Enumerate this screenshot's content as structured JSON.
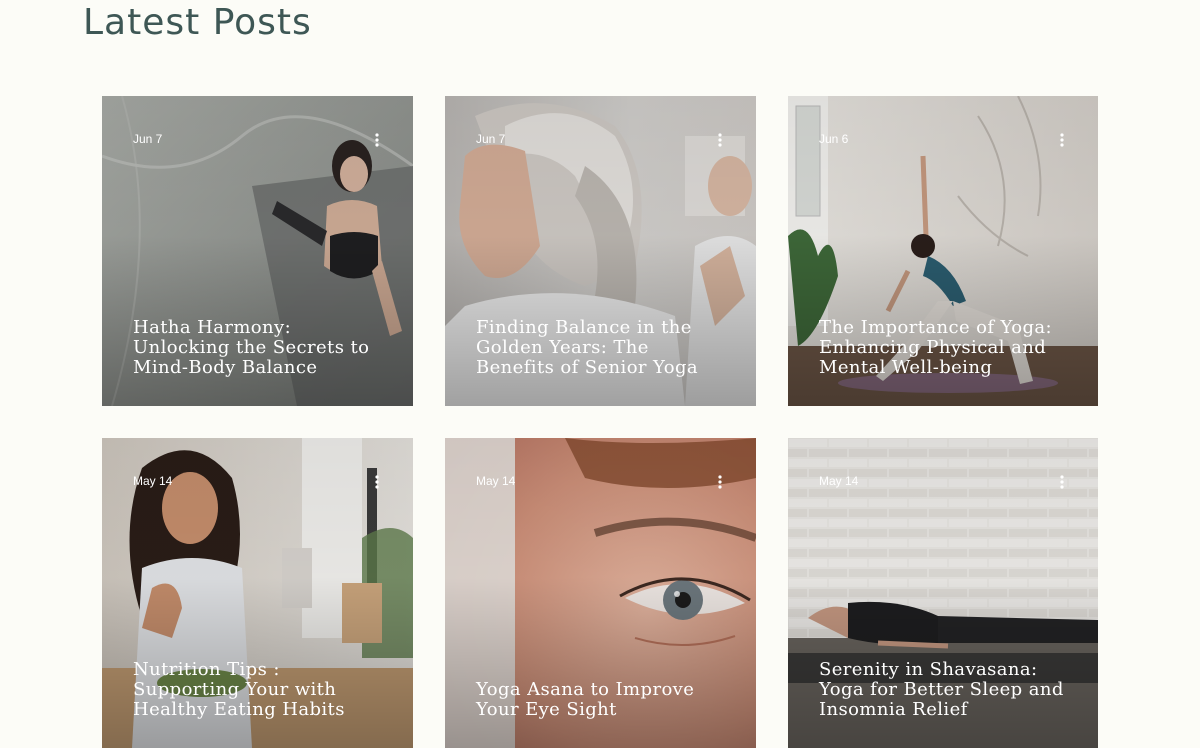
{
  "page": {
    "title": "Latest Posts"
  },
  "posts": [
    {
      "date": "Jun 7",
      "title": "Hatha Harmony: Unlocking the Secrets to Mind-Body Balance",
      "image": "woman-yoga-mat-stone-floor",
      "colors": [
        "#9ea19c",
        "#7e837f"
      ]
    },
    {
      "date": "Jun 7",
      "title": "Finding Balance in the Golden Years: The Benefits of Senior Yoga",
      "image": "senior-woman-ponytail",
      "colors": [
        "#c8c6c4",
        "#a9a5a2"
      ]
    },
    {
      "date": "Jun 6",
      "title": "The Importance of Yoga: Enhancing Physical and Mental Well-being",
      "image": "woman-yoga-pose-marble-room",
      "colors": [
        "#ddd8d2",
        "#7b6a5c"
      ]
    },
    {
      "date": "May 14",
      "title": "Nutrition Tips : Supporting Your with Healthy Eating Habits",
      "image": "woman-eating-salad",
      "colors": [
        "#c9bfb4",
        "#8a7968"
      ]
    },
    {
      "date": "May 14",
      "title": "Yoga Asana to Improve Your Eye Sight",
      "image": "close-up-eye",
      "colors": [
        "#d9a792",
        "#a86b55"
      ]
    },
    {
      "date": "May 14",
      "title": "Serenity in Shavasana: Yoga for Better Sleep and Insomnia Relief",
      "image": "woman-lying-shavasana-brick-wall",
      "colors": [
        "#e6e4e0",
        "#5a5651"
      ]
    }
  ]
}
